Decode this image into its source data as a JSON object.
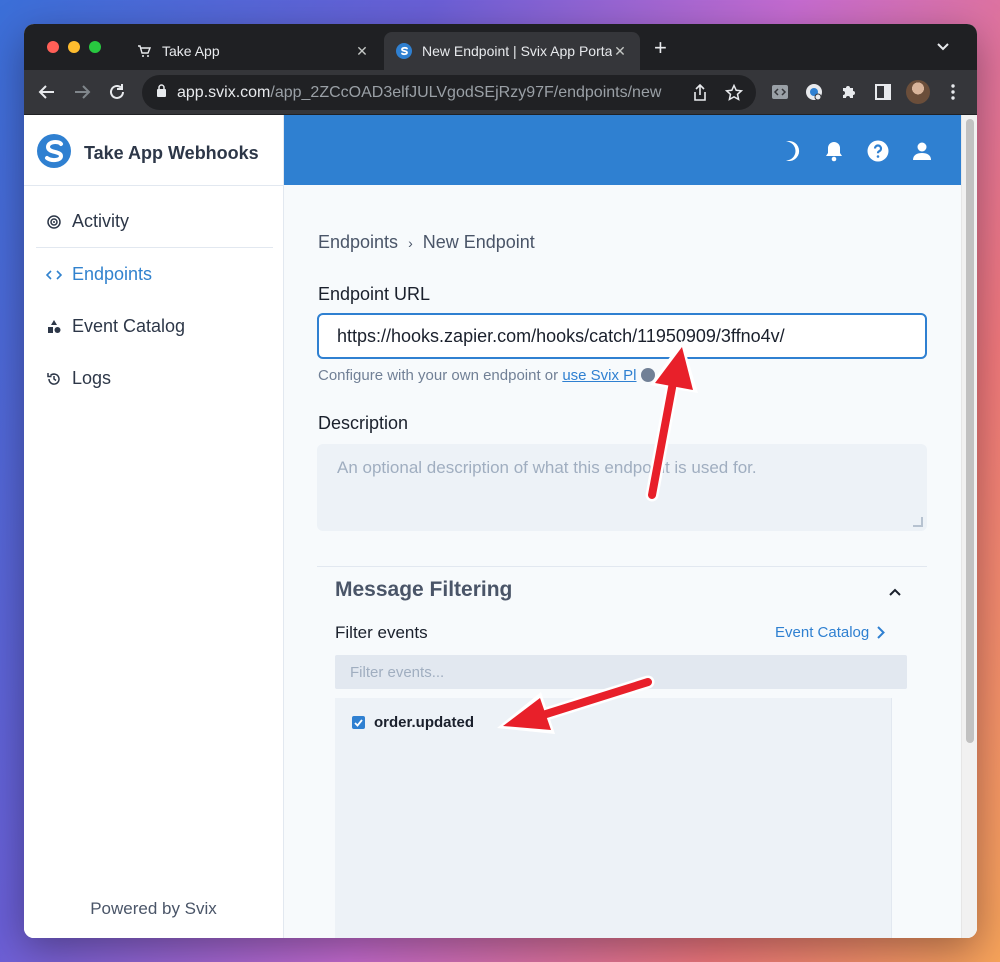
{
  "browser": {
    "tabs": [
      {
        "title": "Take App",
        "favicon": "cart-icon",
        "active": false
      },
      {
        "title": "New Endpoint | Svix App Portal",
        "favicon": "svix-logo-icon",
        "active": true
      }
    ],
    "address": {
      "host": "app.svix.com",
      "path": "/app_2ZCcOAD3elfJULVgodSEjRzy97F/endpoints/new"
    }
  },
  "sidebar": {
    "brand": "Take App Webhooks",
    "items": [
      {
        "label": "Activity",
        "icon": "activity-icon",
        "active": false
      },
      {
        "label": "Endpoints",
        "icon": "code-icon",
        "active": true
      },
      {
        "label": "Event Catalog",
        "icon": "shapes-icon",
        "active": false
      },
      {
        "label": "Logs",
        "icon": "history-icon",
        "active": false
      }
    ],
    "footer": "Powered by Svix"
  },
  "topbar": {
    "icons": [
      "moon-icon",
      "bell-icon",
      "help-icon",
      "user-icon"
    ]
  },
  "colors": {
    "accent": "#2f80d1",
    "annotation_arrow": "#e8202a"
  },
  "main": {
    "breadcrumb": {
      "parent": "Endpoints",
      "current": "New Endpoint"
    },
    "endpoint_url": {
      "label": "Endpoint URL",
      "value": "https://hooks.zapier.com/hooks/catch/11950909/3ffno4v/",
      "helper_text": "Configure with your own endpoint or",
      "helper_link": "use Svix Pl"
    },
    "description": {
      "label": "Description",
      "placeholder": "An optional description of what this endpoint is used for."
    },
    "message_filtering": {
      "title": "Message Filtering",
      "filter_label": "Filter events",
      "catalog_link": "Event Catalog",
      "filter_placeholder": "Filter events...",
      "events": [
        {
          "name": "order.updated",
          "checked": true
        }
      ]
    }
  }
}
